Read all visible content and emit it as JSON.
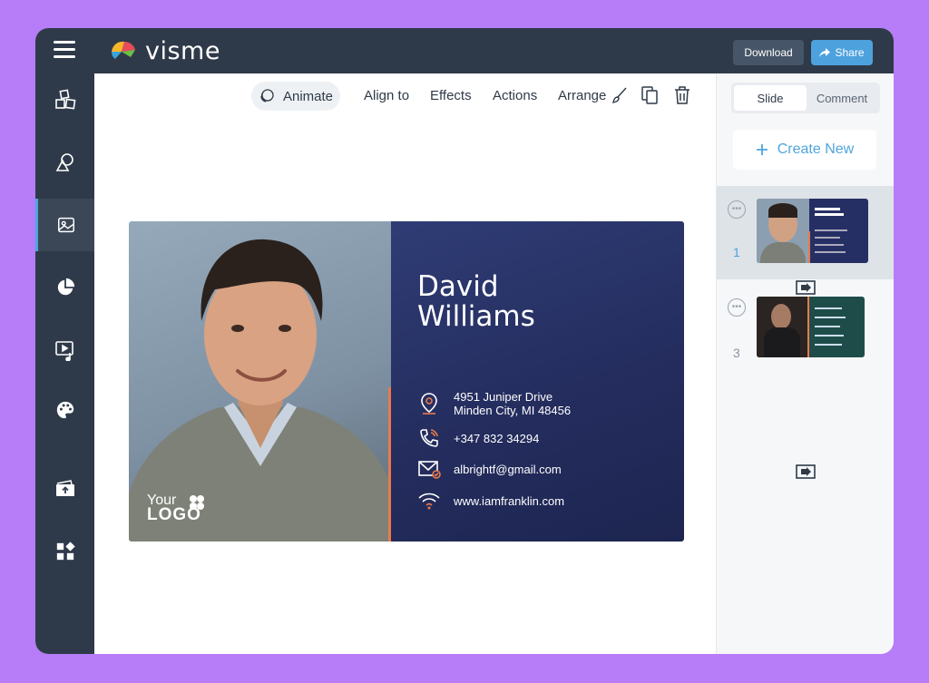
{
  "app": {
    "name": "visme"
  },
  "topbar": {
    "download_label": "Download",
    "share_label": "Share"
  },
  "toolbar": {
    "animate_label": "Animate",
    "align_label": "Align to",
    "effects_label": "Effects",
    "actions_label": "Actions",
    "arrange_label": "Arrange"
  },
  "sidebar": {
    "items": [
      {
        "icon": "text-blocks-icon"
      },
      {
        "icon": "shapes-icon"
      },
      {
        "icon": "image-icon",
        "active": true
      },
      {
        "icon": "chart-icon"
      },
      {
        "icon": "media-icon"
      },
      {
        "icon": "palette-icon"
      },
      {
        "icon": "upload-icon"
      },
      {
        "icon": "apps-icon"
      }
    ]
  },
  "card": {
    "name_line1": "David",
    "name_line2": "Williams",
    "address_line1": "4951 Juniper Drive",
    "address_line2": "Minden City, MI 48456",
    "phone": "+347 832 34294",
    "email": "albrightf@gmail.com",
    "website": "www.iamfranklin.com",
    "logo_line1": "Your",
    "logo_line2": "LOGO",
    "accent": "#e97a4c",
    "panel_color": "#262f63"
  },
  "panel": {
    "tab_slide": "Slide",
    "tab_comment": "Comment",
    "create_new": "Create New",
    "slides": [
      {
        "number": "1",
        "selected": true
      },
      {
        "number": "3",
        "selected": false
      }
    ]
  },
  "colors": {
    "brand_purple": "#b77cf7",
    "dark": "#2e3a49",
    "accent_blue": "#4da2de"
  }
}
